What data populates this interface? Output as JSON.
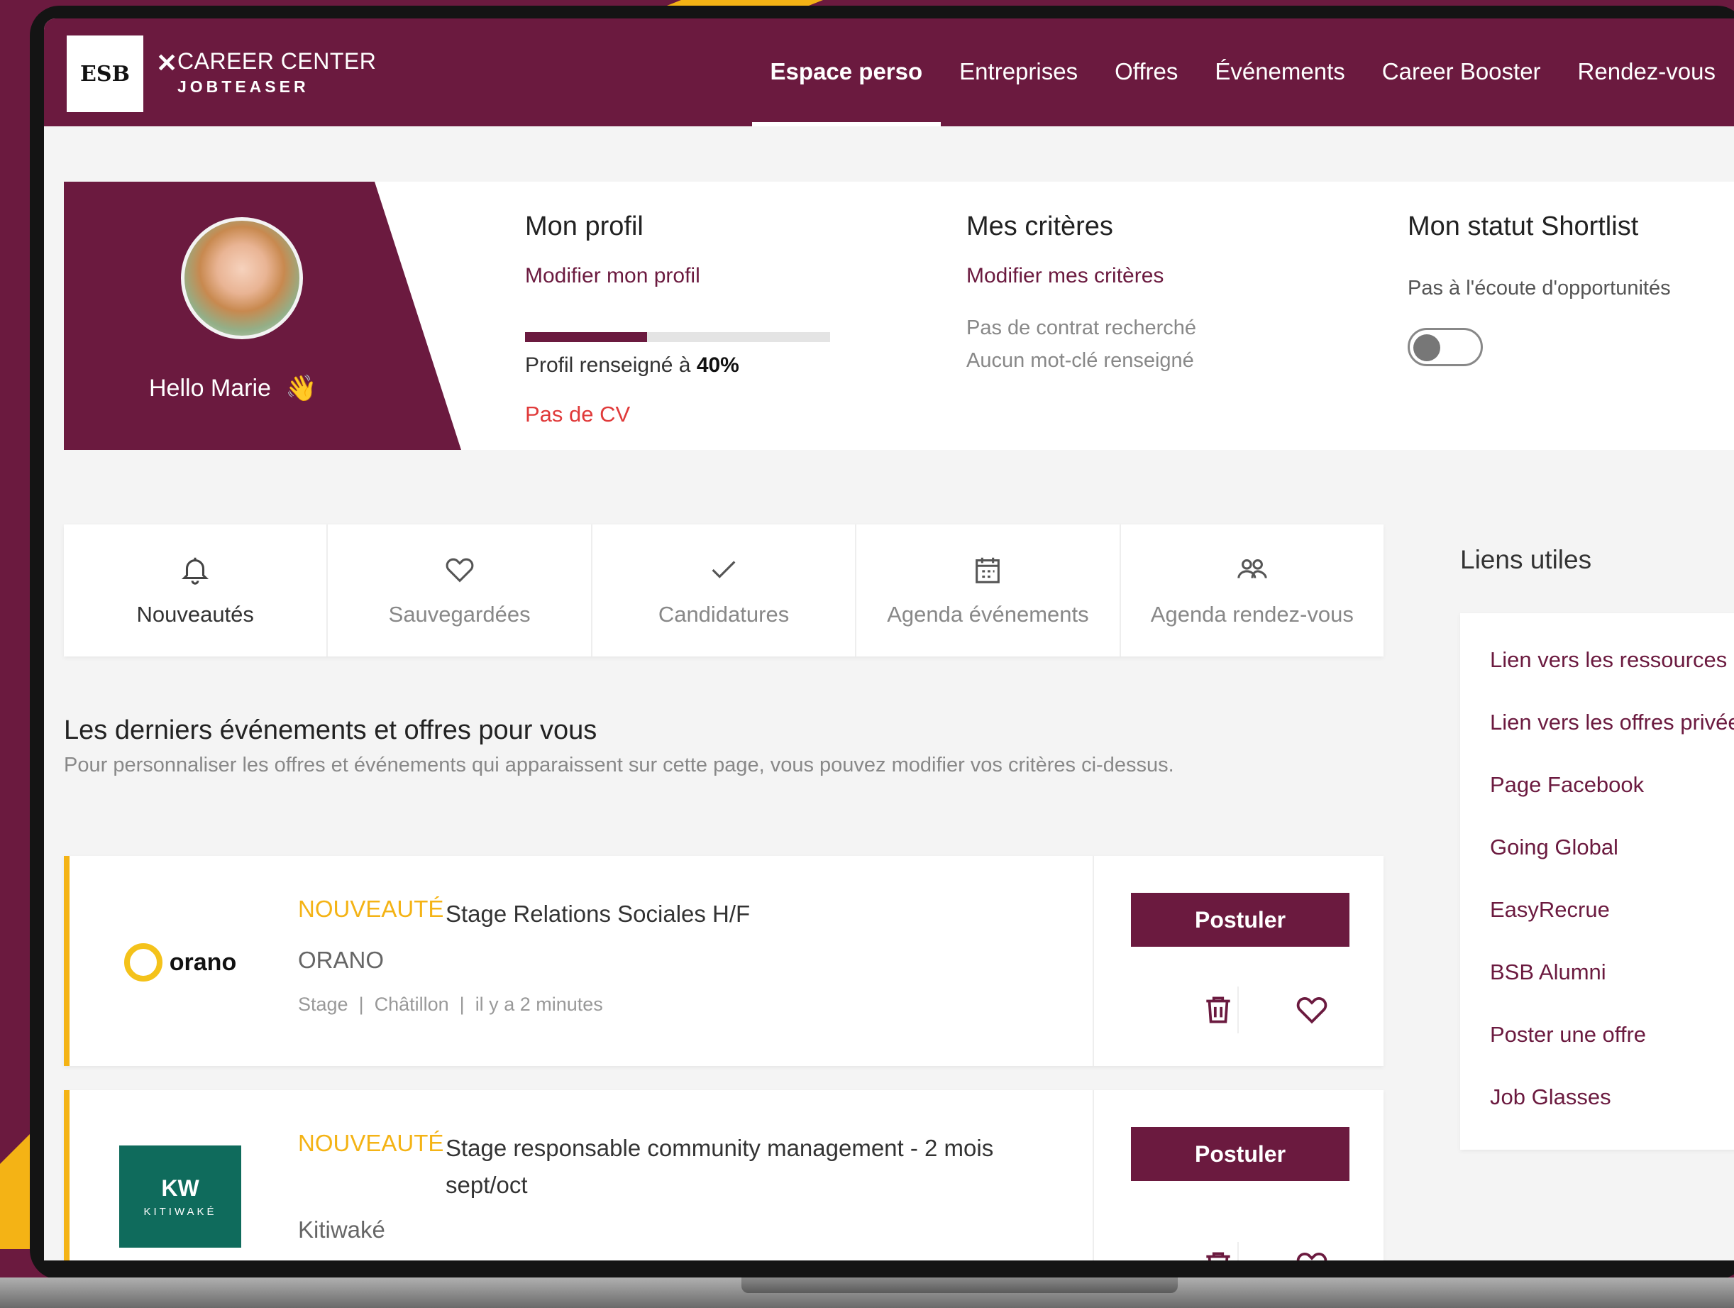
{
  "header": {
    "logo_text": "ESB",
    "brand_top": "CAREER CENTER",
    "brand_bottom": "JOBTEASER",
    "nav": [
      "Espace perso",
      "Entreprises",
      "Offres",
      "Événements",
      "Career Booster",
      "Rendez-vous"
    ],
    "active_nav": "Espace perso"
  },
  "profile": {
    "greeting": "Hello Marie",
    "greeting_emoji": "👋",
    "mon_profil": {
      "title": "Mon profil",
      "link": "Modifier mon profil",
      "progress_prefix": "Profil renseigné à",
      "progress_value": "40%",
      "progress_fraction": 0.4,
      "cv_status": "Pas de CV"
    },
    "criteres": {
      "title": "Mes critères",
      "link": "Modifier mes critères",
      "line1": "Pas de contrat recherché",
      "line2": "Aucun mot-clé renseigné"
    },
    "shortlist": {
      "title": "Mon statut Shortlist",
      "status": "Pas à l'écoute d'opportunités",
      "toggle_on": false
    }
  },
  "tabs": [
    {
      "label": "Nouveautés",
      "icon": "bell-icon"
    },
    {
      "label": "Sauvegardées",
      "icon": "heart-icon"
    },
    {
      "label": "Candidatures",
      "icon": "check-icon"
    },
    {
      "label": "Agenda événements",
      "icon": "calendar-icon"
    },
    {
      "label": "Agenda rendez-vous",
      "icon": "people-icon"
    }
  ],
  "feed": {
    "title": "Les derniers événements et offres pour vous",
    "subtitle": "Pour personnaliser les offres et événements qui apparaissent sur cette page, vous pouvez modifier vos critères ci-dessus."
  },
  "offers": [
    {
      "badge": "NOUVEAUTÉ",
      "title": "Stage Relations Sociales H/F",
      "company": "ORANO",
      "logo_text": "orano",
      "meta_type": "Stage",
      "meta_location": "Châtillon",
      "meta_time": "il y a 2 minutes",
      "apply": "Postuler"
    },
    {
      "badge": "NOUVEAUTÉ",
      "title": "Stage responsable community management - 2 mois sept/oct",
      "company": "Kitiwaké",
      "logo_text": "KITIWAKÉ",
      "logo_mark": "KW",
      "apply": "Postuler"
    }
  ],
  "links": {
    "title": "Liens utiles",
    "items": [
      "Lien vers les ressources",
      "Lien vers les offres privées",
      "Page Facebook",
      "Going Global",
      "EasyRecrue",
      "BSB Alumni",
      "Poster une offre",
      "Job Glasses"
    ]
  },
  "colors": {
    "brand": "#6b1a3f",
    "accent": "#f4b315",
    "alert": "#e03a3a"
  }
}
